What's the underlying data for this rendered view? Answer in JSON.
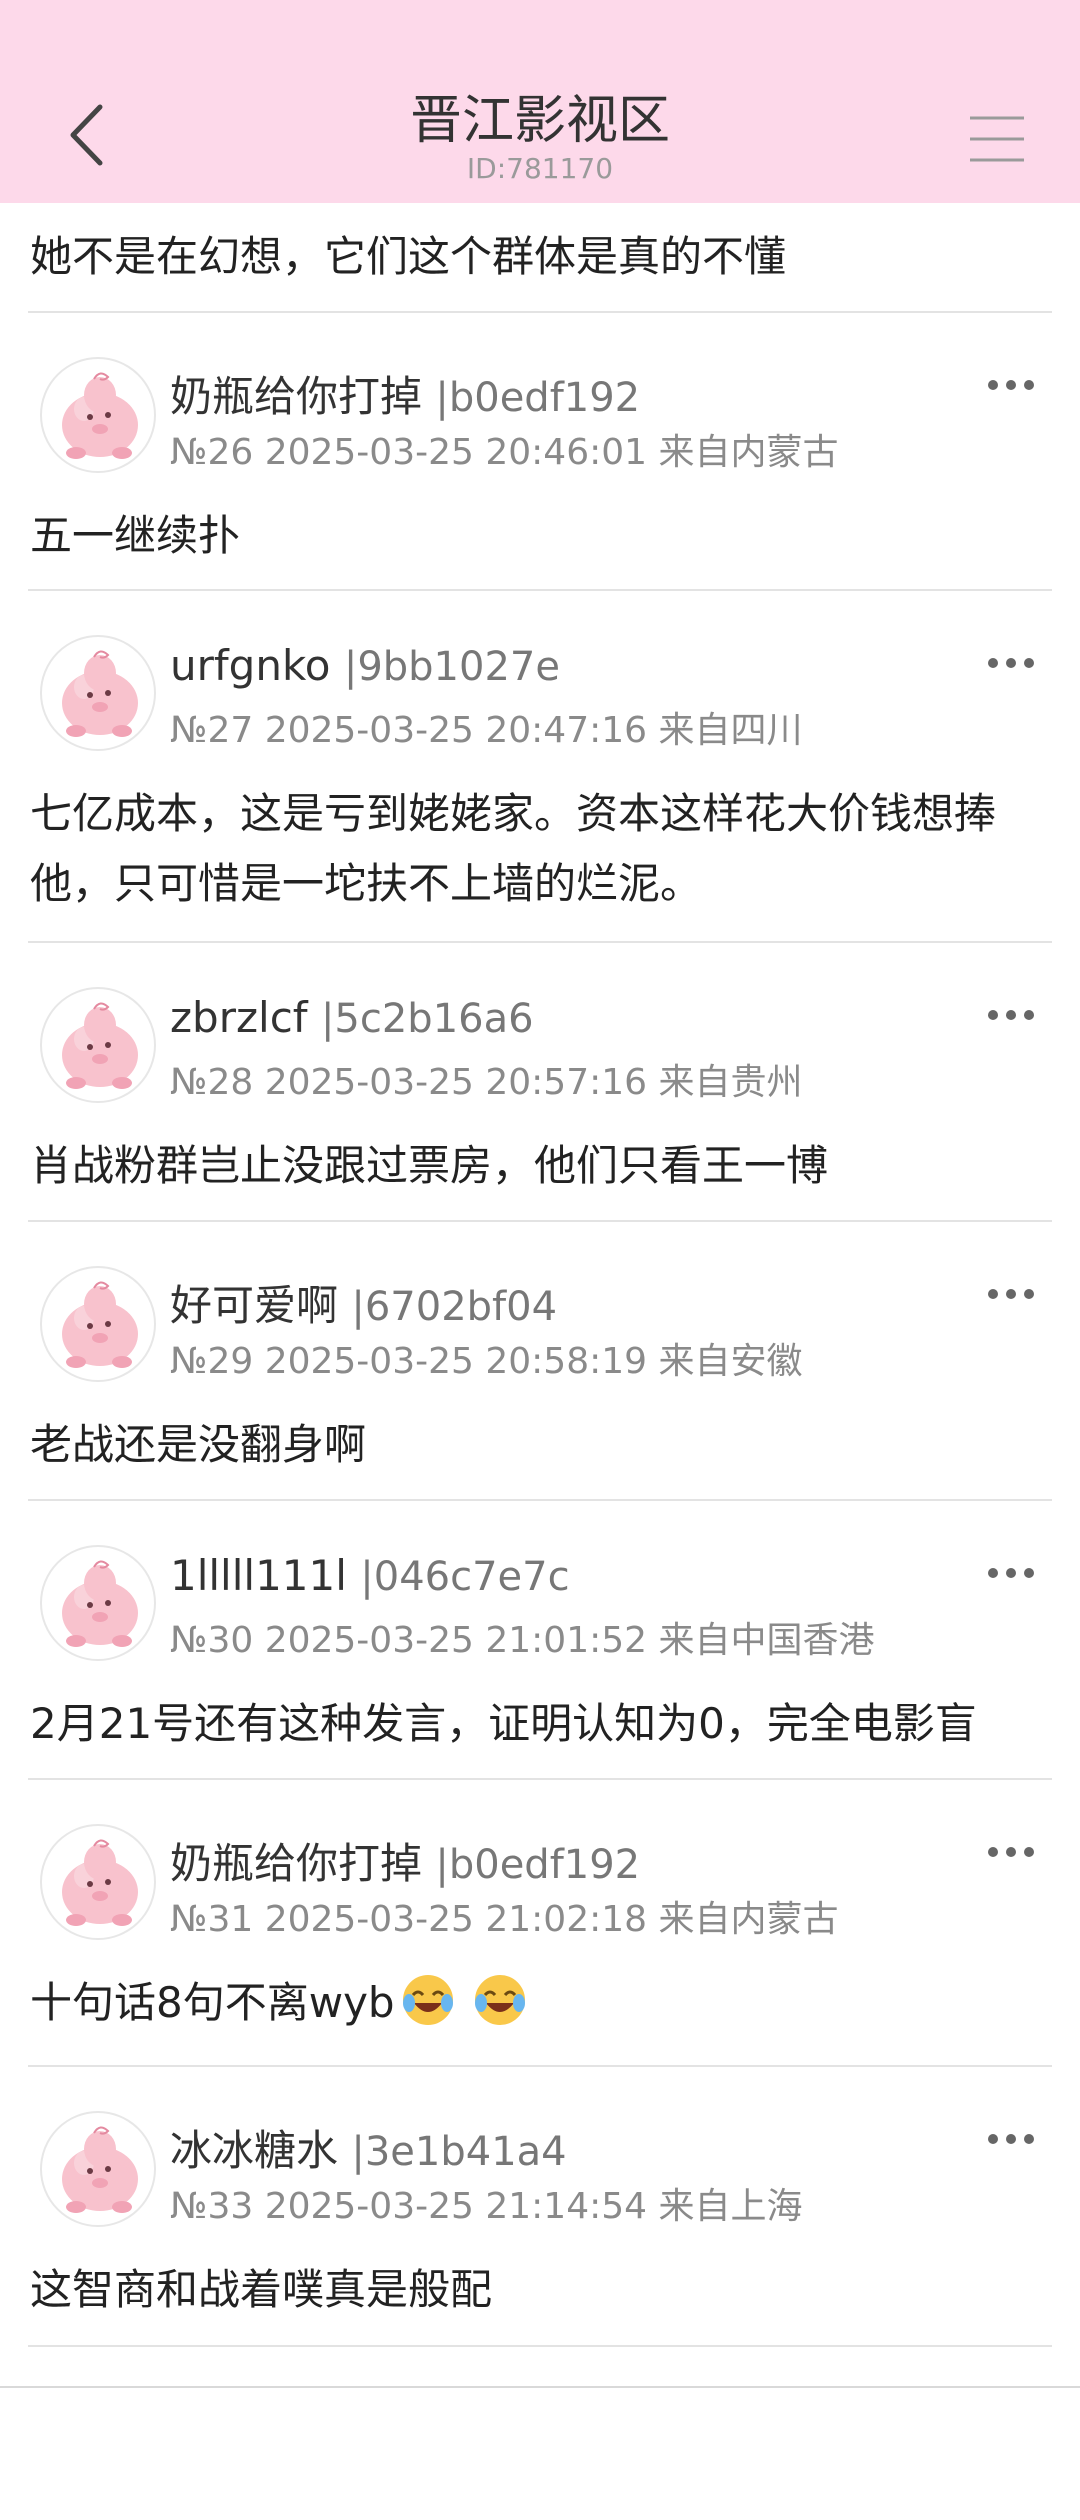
{
  "header": {
    "title": "晋江影视区",
    "subtitle": "ID:781170"
  },
  "prev_post": {
    "text": "她不是在幻想，它们这个群体是真的不懂"
  },
  "posts": [
    {
      "name": "奶瓶给你打掉",
      "uid": "|b0edf192",
      "meta": "№26 2025-03-25 20:46:01 来自内蒙古",
      "text": "五一继续扑"
    },
    {
      "name": "urfgnko",
      "uid": "|9bb1027e",
      "meta": "№27 2025-03-25 20:47:16 来自四川",
      "text": "七亿成本，这是亏到姥姥家。资本这样花大价钱想捧他，只可惜是一坨扶不上墙的烂泥。"
    },
    {
      "name": "zbrzlcf",
      "uid": "|5c2b16a6",
      "meta": "№28 2025-03-25 20:57:16 来自贵州",
      "text": "肖战粉群岂止没跟过票房，他们只看王一博"
    },
    {
      "name": "好可爱啊",
      "uid": "|6702bf04",
      "meta": "№29 2025-03-25 20:58:19 来自安徽",
      "text": "老战还是没翻身啊"
    },
    {
      "name": "1lllll111l",
      "uid": "|046c7e7c",
      "meta": "№30 2025-03-25 21:01:52 来自中国香港",
      "text": "2月21号还有这种发言，证明认知为0，完全电影盲"
    },
    {
      "name": "奶瓶给你打掉",
      "uid": "|b0edf192",
      "meta": "№31 2025-03-25 21:02:18 来自内蒙古",
      "text": "十句话8句不离wyb",
      "emoji": [
        "face-with-tears-of-joy-icon",
        "face-with-tears-of-joy-icon"
      ]
    },
    {
      "name": "冰冰糖水",
      "uid": "|3e1b41a4",
      "meta": "№33 2025-03-25 21:14:54 来自上海",
      "text": "这智商和战着噗真是般配"
    }
  ],
  "icons": {
    "back": "chevron-left-icon",
    "menu": "hamburger-menu-icon",
    "more": "more-dots-icon",
    "avatar": "pink-pig-avatar-icon"
  },
  "colors": {
    "header_bg": "#fdd9ea",
    "divider": "#e3e3e3",
    "text": "#222222",
    "meta": "#8a8a8a"
  }
}
